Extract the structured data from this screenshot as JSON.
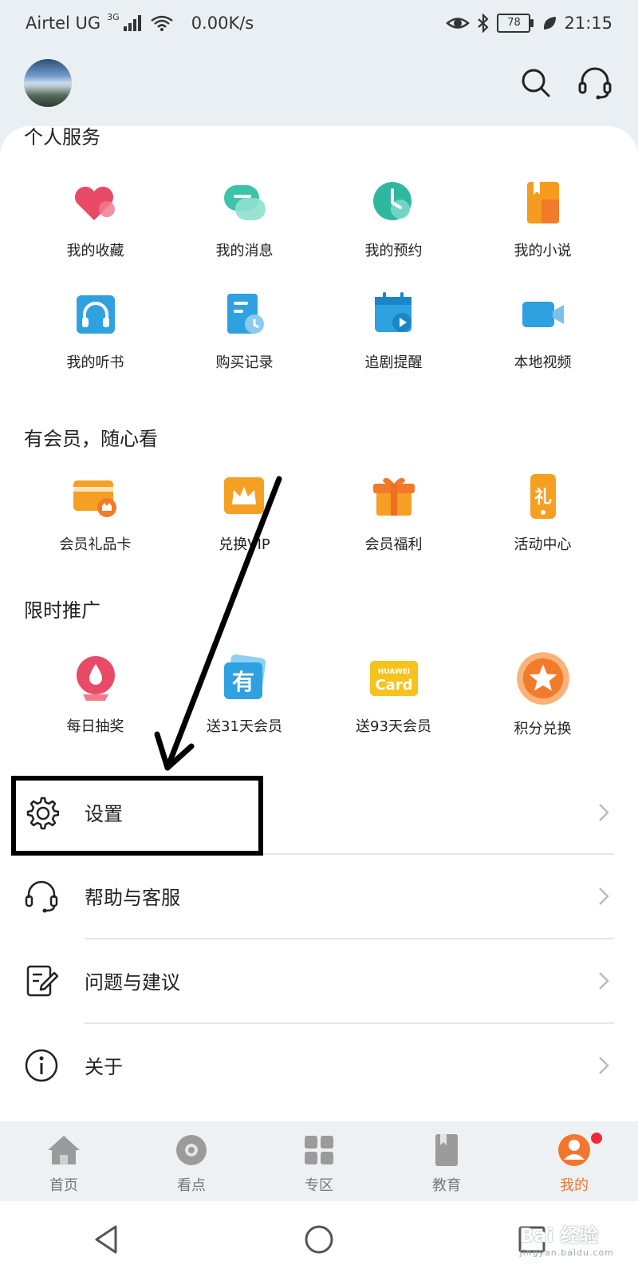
{
  "status_bar": {
    "carrier": "Airtel UG",
    "network": "3G",
    "speed": "0.00K/s",
    "battery": "78",
    "time": "21:15"
  },
  "top_bar": {
    "search_icon": "search-icon",
    "support_icon": "headset-icon"
  },
  "personal_services": {
    "title": "个人服务",
    "items": [
      {
        "label": "我的收藏",
        "icon": "heart-icon"
      },
      {
        "label": "我的消息",
        "icon": "chat-bubbles-icon"
      },
      {
        "label": "我的预约",
        "icon": "clock-icon"
      },
      {
        "label": "我的小说",
        "icon": "book-icon"
      },
      {
        "label": "我的听书",
        "icon": "headphones-icon"
      },
      {
        "label": "购买记录",
        "icon": "receipt-icon"
      },
      {
        "label": "追剧提醒",
        "icon": "calendar-play-icon"
      },
      {
        "label": "本地视频",
        "icon": "video-camera-icon"
      }
    ]
  },
  "vip": {
    "title": "有会员，随心看",
    "items": [
      {
        "label": "会员礼品卡",
        "icon": "gift-card-icon"
      },
      {
        "label": "兑换VIP",
        "icon": "crown-icon"
      },
      {
        "label": "会员福利",
        "icon": "gift-box-icon"
      },
      {
        "label": "活动中心",
        "icon": "phone-gift-icon"
      }
    ]
  },
  "promo": {
    "title": "限时推广",
    "items": [
      {
        "label": "每日抽奖",
        "icon": "lottery-icon"
      },
      {
        "label": "送31天会员",
        "icon": "you-badge-icon"
      },
      {
        "label": "送93天会员",
        "icon": "huawei-card-icon",
        "badge_line1": "HUAWEI",
        "badge_line2": "Card"
      },
      {
        "label": "积分兑换",
        "icon": "star-coin-icon"
      }
    ]
  },
  "menu": [
    {
      "label": "设置",
      "icon": "gear-icon"
    },
    {
      "label": "帮助与客服",
      "icon": "headset-icon"
    },
    {
      "label": "问题与建议",
      "icon": "feedback-icon"
    },
    {
      "label": "关于",
      "icon": "info-icon"
    }
  ],
  "tabs": [
    {
      "label": "首页",
      "icon": "home-icon"
    },
    {
      "label": "看点",
      "icon": "camera-dot-icon"
    },
    {
      "label": "专区",
      "icon": "grid-icon"
    },
    {
      "label": "教育",
      "icon": "book-mark-icon"
    },
    {
      "label": "我的",
      "icon": "profile-icon",
      "active": true
    }
  ],
  "watermark": {
    "text": "Bai 经验",
    "sub": "jingyan.baidu.com"
  },
  "colors": {
    "accent": "#f2762e",
    "background": "#e9eff3"
  }
}
